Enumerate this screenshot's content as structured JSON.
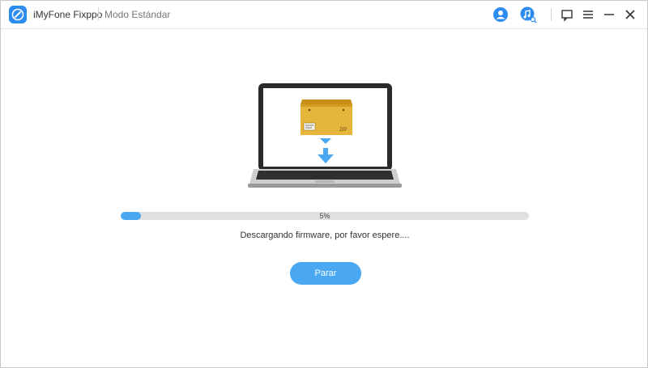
{
  "titlebar": {
    "app_name": "iMyFone Fixppo",
    "mode": "Modo Estándar",
    "icons": [
      "account-icon",
      "music-search-icon",
      "feedback-icon",
      "menu-icon",
      "minimize-icon",
      "close-icon"
    ]
  },
  "illustration": {
    "zip_label": "ZIP"
  },
  "progress": {
    "percent_text": "5%",
    "value": 0.05
  },
  "status": "Descargando firmware, por favor espere....",
  "stop_button": "Parar",
  "colors": {
    "accent": "#4aa8f3",
    "track": "#e0e0e0",
    "box": "#e6b53b"
  }
}
